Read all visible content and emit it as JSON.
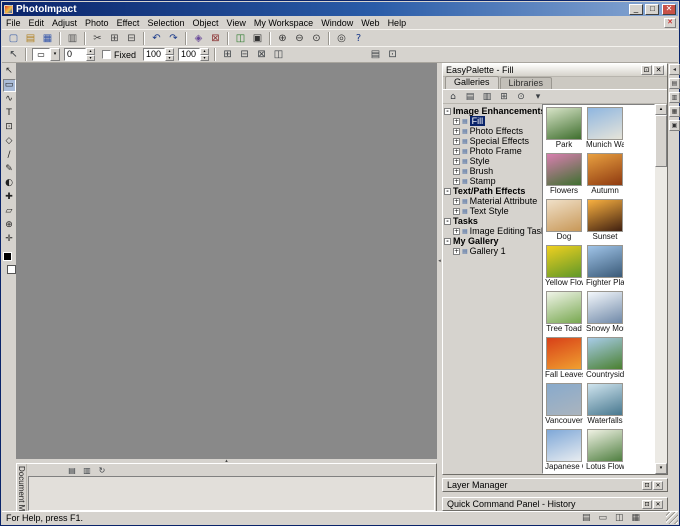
{
  "window": {
    "title": "PhotoImpact",
    "minimize": "_",
    "maximize": "□",
    "close": "✕"
  },
  "glyphs": {
    "up": "▴",
    "down": "▾",
    "left": "◂",
    "collapse": "-",
    "expand": "+",
    "gallery_item": "▦"
  },
  "menu": {
    "items": [
      "File",
      "Edit",
      "Adjust",
      "Photo",
      "Effect",
      "Selection",
      "Object",
      "View",
      "My Workspace",
      "Window",
      "Web",
      "Help"
    ],
    "close_glyph": "✕"
  },
  "toolbar_main": {
    "buttons": [
      {
        "name": "new",
        "glyph": "▢",
        "color": "#4466aa"
      },
      {
        "name": "open",
        "glyph": "▤",
        "color": "#b08020"
      },
      {
        "name": "save",
        "glyph": "▦",
        "color": "#3355aa"
      },
      {
        "sep": true
      },
      {
        "name": "print",
        "glyph": "▥",
        "color": "#555555"
      },
      {
        "sep": true
      },
      {
        "name": "cut",
        "glyph": "✂",
        "color": "#444444"
      },
      {
        "name": "copy",
        "glyph": "⊞",
        "color": "#444444"
      },
      {
        "name": "paste",
        "glyph": "⊟",
        "color": "#444444"
      },
      {
        "sep": true
      },
      {
        "name": "undo",
        "glyph": "↶",
        "color": "#1a3a8a"
      },
      {
        "name": "redo",
        "glyph": "↷",
        "color": "#1a3a8a"
      },
      {
        "sep": true
      },
      {
        "name": "duplicate",
        "glyph": "◈",
        "color": "#6a4a9a"
      },
      {
        "name": "delete",
        "glyph": "⊠",
        "color": "#8a3030"
      },
      {
        "sep": true
      },
      {
        "name": "browse",
        "glyph": "◫",
        "color": "#2a7a2a"
      },
      {
        "name": "full-screen",
        "glyph": "▣",
        "color": "#333333"
      },
      {
        "sep": true
      },
      {
        "name": "zoom-in",
        "glyph": "⊕",
        "color": "#333333"
      },
      {
        "name": "zoom-out",
        "glyph": "⊖",
        "color": "#333333"
      },
      {
        "name": "actual-view",
        "glyph": "⊙",
        "color": "#333333"
      },
      {
        "sep": true
      },
      {
        "name": "fit-in-window",
        "glyph": "◎",
        "color": "#333333"
      },
      {
        "name": "help",
        "glyph": "?",
        "color": "#1a3a8a"
      }
    ]
  },
  "toolbar_attr": {
    "preset_glyph": "↖",
    "dropdown_glyph": "▾",
    "shape_glyph": "▭",
    "softness": "0",
    "fixed_label": "Fixed",
    "width": "100",
    "height": "100",
    "buttons": [
      {
        "name": "new-selection-mode",
        "glyph": "⊞"
      },
      {
        "name": "add-selection-mode",
        "glyph": "⊟"
      },
      {
        "name": "subtract-selection-mode",
        "glyph": "⊠"
      },
      {
        "name": "preserve-base-image",
        "glyph": "◫"
      }
    ],
    "right_buttons": [
      {
        "name": "options",
        "glyph": "▤"
      },
      {
        "name": "panel-switch",
        "glyph": "⊡"
      }
    ]
  },
  "toolbox": {
    "tools": [
      {
        "name": "pick-tool",
        "glyph": "↖"
      },
      {
        "name": "standard-selection-tool",
        "glyph": "▭",
        "active": true
      },
      {
        "name": "lasso-tool",
        "glyph": "∿"
      },
      {
        "name": "text-tool",
        "glyph": "T"
      },
      {
        "name": "crop-tool",
        "glyph": "⊡"
      },
      {
        "name": "transform-tool",
        "glyph": "◇"
      },
      {
        "name": "eyedropper-tool",
        "glyph": "∕"
      },
      {
        "name": "paintbrush-tool",
        "glyph": "✎"
      },
      {
        "name": "clone-tool",
        "glyph": "◐"
      },
      {
        "name": "retouch-tool",
        "glyph": "✚"
      },
      {
        "name": "eraser-tool",
        "glyph": "▱"
      },
      {
        "name": "zoom-tool",
        "glyph": "⊕"
      },
      {
        "name": "pan-tool",
        "glyph": "✛"
      }
    ]
  },
  "easypalette": {
    "title": "EasyPalette - Fill",
    "rollup_glyph": "⊡",
    "close_glyph": "✕",
    "active_tab": 0,
    "tabs": [
      "Galleries",
      "Libraries"
    ],
    "toolbar": [
      {
        "name": "home",
        "glyph": "⌂"
      },
      {
        "name": "galleries-view",
        "glyph": "▤"
      },
      {
        "name": "libraries-view",
        "glyph": "▥"
      },
      {
        "name": "add-gallery",
        "glyph": "⊞"
      },
      {
        "name": "find",
        "glyph": "⊙"
      },
      {
        "name": "palette-menu",
        "glyph": "▾"
      }
    ],
    "tree": [
      {
        "label": "Image Enhancements",
        "children": [
          {
            "label": "Fill",
            "selected": true
          },
          {
            "label": "Photo Effects"
          },
          {
            "label": "Special Effects"
          },
          {
            "label": "Photo Frame"
          },
          {
            "label": "Style"
          },
          {
            "label": "Brush"
          },
          {
            "label": "Stamp"
          }
        ]
      },
      {
        "label": "Text/Path Effects",
        "children": [
          {
            "label": "Material Attribute"
          },
          {
            "label": "Text Style"
          }
        ]
      },
      {
        "label": "Tasks",
        "children": [
          {
            "label": "Image Editing Tasks"
          }
        ]
      },
      {
        "label": "My Gallery",
        "children": [
          {
            "label": "Gallery 1"
          }
        ]
      }
    ],
    "thumbnails": [
      {
        "name": "Park",
        "c1": "#d8e4c8",
        "c2": "#3f6f2e"
      },
      {
        "name": "Munich Wat...",
        "c1": "#8fb6e0",
        "c2": "#e6e4da"
      },
      {
        "name": "Flowers",
        "c1": "#d97fb0",
        "c2": "#3f7030"
      },
      {
        "name": "Autumn",
        "c1": "#e8a040",
        "c2": "#8f3a10"
      },
      {
        "name": "Dog",
        "c1": "#f0e0c8",
        "c2": "#c89858"
      },
      {
        "name": "Sunset",
        "c1": "#f8b040",
        "c2": "#402010"
      },
      {
        "name": "Yellow Flowe...",
        "c1": "#f0d020",
        "c2": "#5f9828"
      },
      {
        "name": "Fighter Plane",
        "c1": "#a0c4e8",
        "c2": "#3a5a78"
      },
      {
        "name": "Tree Toad",
        "c1": "#f0f4e8",
        "c2": "#78a850"
      },
      {
        "name": "Snowy Moun...",
        "c1": "#f4f8fc",
        "c2": "#7089a8"
      },
      {
        "name": "Fall Leaves",
        "c1": "#d84018",
        "c2": "#f0a030"
      },
      {
        "name": "Countryside...",
        "c1": "#a8cce8",
        "c2": "#4a8030"
      },
      {
        "name": "Vancouver",
        "c1": "#88aacc",
        "c2": "#aab4be"
      },
      {
        "name": "Waterfalls",
        "c1": "#cfe4ee",
        "c2": "#48788f"
      },
      {
        "name": "Japanese Ch...",
        "c1": "#7fa8d8",
        "c2": "#e8ecf0"
      },
      {
        "name": "Lotus Flower",
        "c1": "#f0f2e4",
        "c2": "#4f7f40"
      }
    ]
  },
  "dock": {
    "buttons": [
      {
        "name": "hide-dock-button",
        "glyph": "◂"
      },
      {
        "name": "easypalette-dock-button",
        "glyph": "▤"
      },
      {
        "name": "layer-manager-dock-button",
        "glyph": "▥"
      },
      {
        "name": "document-manager-dock-button",
        "glyph": "▦"
      },
      {
        "name": "quick-command-dock-button",
        "glyph": "▣"
      }
    ]
  },
  "panels": {
    "document_manager": "Document Mana",
    "layer_manager": "Layer Manager",
    "quick_command": "Quick Command Panel - History",
    "rollup_glyph": "⊡",
    "close_glyph": "✕",
    "docman_toolbar": [
      {
        "name": "thumbnail-view",
        "glyph": "▤"
      },
      {
        "name": "list-view",
        "glyph": "▥"
      },
      {
        "name": "refresh",
        "glyph": "↻"
      }
    ]
  },
  "statusbar": {
    "help_text": "For Help, press F1.",
    "icons": [
      {
        "name": "image-info-icon",
        "glyph": "▤"
      },
      {
        "name": "selection-info-icon",
        "glyph": "▭"
      },
      {
        "name": "object-info-icon",
        "glyph": "◫"
      },
      {
        "name": "memory-info-icon",
        "glyph": "▦"
      }
    ]
  }
}
